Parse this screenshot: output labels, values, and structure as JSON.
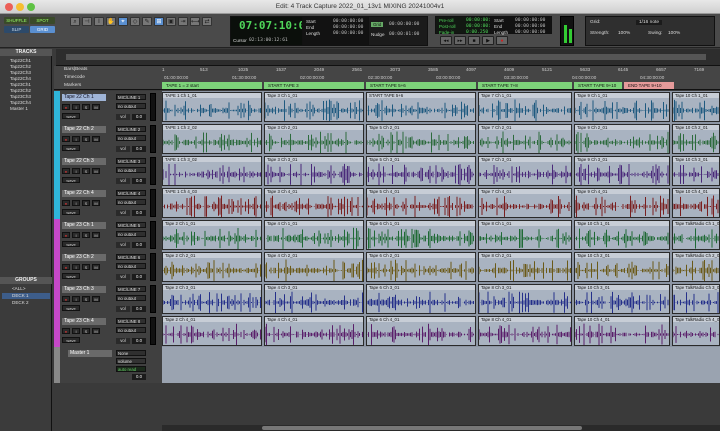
{
  "window": {
    "title": "Edit: 4 Track Capture 2022_01_13v1 MIXING 20241004v1"
  },
  "modes": {
    "shuffle": "SHUFFLE",
    "spot": "SPOT",
    "slip": "SLIP",
    "grid": "GRID"
  },
  "counter": {
    "main": "07:07:10:00",
    "cursor_label": "Cursor",
    "cursor_value": "02:13:00:12:61",
    "db": "-6.5 db"
  },
  "selection": {
    "start_label": "Start",
    "end_label": "End",
    "length_label": "Length",
    "start": "00:00:00:00",
    "end": "00:00:00:00",
    "length": "00:00:00:00"
  },
  "nudge": {
    "label": "Nudge",
    "value": "00:00:01:00",
    "grid_label": "Grid",
    "grid_value": "00:00:00:00"
  },
  "preroll": {
    "pre_label": "Pre-roll",
    "post_label": "Post-roll",
    "fade_label": "Fade-in",
    "pre": "00:00:00:00",
    "post": "00:00:00:00",
    "fade": "0:00.250",
    "start_label": "Start",
    "end_label": "End",
    "length_label": "Length",
    "start": "00:00:00:00",
    "end": "00:00:00:00",
    "length": "00:00:00:00"
  },
  "gridctrl": {
    "grid_label": "Grid:",
    "grid_value": "1/16 note",
    "strength_label": "Strength:",
    "strength_value": "100%",
    "swing_label": "Swing:",
    "swing_value": "100%"
  },
  "sidebar": {
    "tracks_title": "TRACKS",
    "tracks": [
      "Tap22Ch1",
      "Tap22Ch2",
      "Tap22Ch3",
      "Tap22Ch4",
      "Tap23Ch1",
      "Tap23Ch2",
      "Tap23Ch3",
      "Tap23Ch4",
      "Master 1"
    ],
    "groups_title": "GROUPS",
    "groups": [
      "<ALL>",
      "DECK 1",
      "DECK 2"
    ]
  },
  "rulers": {
    "barsbeats_label": "Bars|Beats",
    "timecode_label": "Timecode",
    "markers_label": "Markers",
    "bars": [
      "1",
      "513",
      "1025",
      "1537",
      "2049",
      "2561",
      "3073",
      "3585",
      "4097",
      "4609",
      "5121",
      "5633",
      "6145",
      "6657",
      "7169"
    ],
    "timecode": [
      "01:00:00:00",
      "01:30:00:00",
      "02:00:00:00",
      "02:30:00:00",
      "03:00:00:00",
      "03:30:00:00",
      "04:00:00:00",
      "04:30:00:00"
    ],
    "markers": [
      "TAPE 1 = 2 start",
      "START TAPE 3",
      "START TAPE 5+6",
      "START TAPE 7+8",
      "START TAPE 9+10",
      "END TAPE 9+10"
    ]
  },
  "io": {
    "header": "I/O",
    "in": "MIC/LINE 1",
    "out": "no output",
    "vol_label": "vol",
    "vol_value": "0.0"
  },
  "tracks": [
    {
      "name": "Tape 22 Ch 1",
      "color": "#2fb5d9",
      "wave": "#1f5a80",
      "input": "MIC/LINE 1",
      "output": "no output",
      "clips": [
        "TAPE 1 Ch 1_01",
        "Tape 3 Ch 1_01",
        "START TAPE 5+6",
        "Tape 7 Ch 1_01",
        "Tape 9 Ch 1_01",
        "Tape 10 Ch 1_01"
      ]
    },
    {
      "name": "Tape 22 Ch 2",
      "color": "#2fb5d9",
      "wave": "#2d6b3d",
      "input": "MIC/LINE 2",
      "output": "no output",
      "clips": [
        "TAPE 1 Ch 2_02",
        "Tape 3 Ch 2_01",
        "Tape 5 Ch 2_01",
        "Tape 7 Ch 2_01",
        "Tape 9 Ch 2_01",
        "Tape 10 Ch 2_01"
      ]
    },
    {
      "name": "Tape 22 Ch 3",
      "color": "#2fb5d9",
      "wave": "#4a2a7a",
      "input": "MIC/LINE 3",
      "output": "no output",
      "clips": [
        "TAPE 1 Ch 3_02",
        "Tape 3 Ch 3_01",
        "Tape 5 Ch 3_01",
        "Tape 7 Ch 3_01",
        "Tape 9 Ch 3_01",
        "Tape 10 Ch 3_01"
      ]
    },
    {
      "name": "Tape 22 Ch 4",
      "color": "#2fb5d9",
      "wave": "#7a1f1f",
      "input": "MIC/LINE 4",
      "output": "no output",
      "clips": [
        "TAPE 1 Ch 4_03",
        "Tape 3 Ch 4_01",
        "Tape 5 Ch 4_01",
        "Tape 7 Ch 4_01",
        "Tape 9 Ch 4_01",
        "Tape 10 Ch 4_01"
      ]
    },
    {
      "name": "Tape 23 Ch 1",
      "color": "#c548c8",
      "wave": "#1f6a35",
      "input": "MIC/LINE 5",
      "output": "no output",
      "clips": [
        "Tape 2 Ch 1_01",
        "Tape 4 Ch 1_01",
        "Tape 6 Ch 1_01",
        "Tape 8 Ch 1_01",
        "Tape 10 Ch 1_01",
        "Tape TalkRadio Ch 1_01"
      ]
    },
    {
      "name": "Tape 23 Ch 2",
      "color": "#c548c8",
      "wave": "#6b5a18",
      "input": "MIC/LINE 6",
      "output": "no output",
      "clips": [
        "Tape 2 Ch 2_01",
        "Tape 4 Ch 2_01",
        "Tape 6 Ch 2_01",
        "Tape 8 Ch 2_01",
        "Tape 10 Ch 2_01",
        "Tape TalkRadio Ch 2_01"
      ]
    },
    {
      "name": "Tape 23 Ch 3",
      "color": "#c548c8",
      "wave": "#25308a",
      "input": "MIC/LINE 7",
      "output": "no output",
      "clips": [
        "Tape 2 Ch 3_01",
        "Tape 4 Ch 3_01",
        "Tape 6 Ch 3_01",
        "Tape 8 Ch 3_01",
        "Tape 10 Ch 3_01",
        "Tape TalkRadio Ch 3_01"
      ]
    },
    {
      "name": "Tape 23 Ch 4",
      "color": "#c548c8",
      "wave": "#5a1f6a",
      "input": "MIC/LINE 8",
      "output": "no output",
      "clips": [
        "Tape 2 Ch 4_01",
        "Tape 4 Ch 4_01",
        "Tape 6 Ch 4_01",
        "Tape 8 Ch 4_01",
        "Tape 10 Ch 4_01",
        "Tape TalkRadio Ch 4_01"
      ]
    }
  ],
  "master": {
    "name": "Master 1",
    "output_label": "None",
    "vol_label": "volume",
    "mode": "auto read",
    "vol_value": "0.0"
  },
  "track_buttons": {
    "rec": "●",
    "input": "I",
    "solo": "S",
    "mute": "M",
    "wave": "wave"
  },
  "transport": {
    "labels": [
      "◂◂",
      "▸▸",
      "■",
      "▶",
      "●"
    ]
  }
}
